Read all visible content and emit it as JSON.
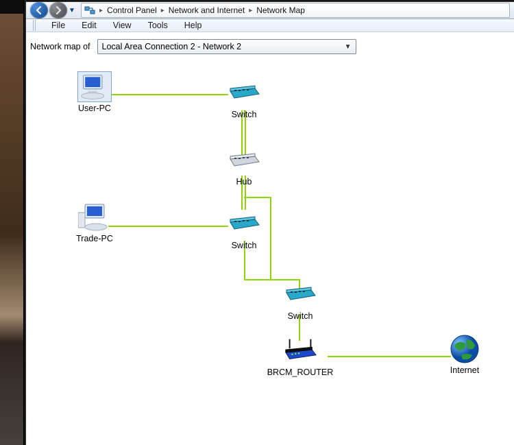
{
  "breadcrumb": {
    "items": [
      "Control Panel",
      "Network and Internet",
      "Network Map"
    ]
  },
  "menubar": {
    "file": "File",
    "edit": "Edit",
    "view": "View",
    "tools": "Tools",
    "help": "Help"
  },
  "mapof": {
    "label": "Network map of",
    "selected": "Local Area Connection 2 - Network  2"
  },
  "nodes": {
    "userpc": "User-PC",
    "switch1": "Switch",
    "hub": "Hub",
    "tradepc": "Trade-PC",
    "switch2": "Switch",
    "switch3": "Switch",
    "router": "BRCM_ROUTER",
    "internet": "Internet"
  }
}
